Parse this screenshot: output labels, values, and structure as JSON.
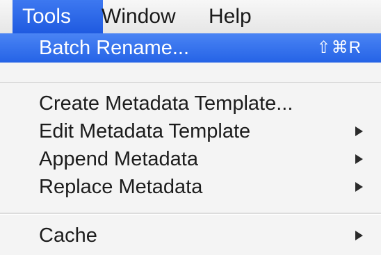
{
  "menubar": {
    "items": [
      {
        "label": "Tools"
      },
      {
        "label": "Window"
      },
      {
        "label": "Help"
      }
    ]
  },
  "menu": {
    "items": [
      {
        "label": "Batch Rename...",
        "shortcut": "⇧⌘R"
      },
      {
        "label": "Create Metadata Template..."
      },
      {
        "label": "Edit Metadata Template"
      },
      {
        "label": "Append Metadata"
      },
      {
        "label": "Replace Metadata"
      },
      {
        "label": "Cache"
      }
    ]
  },
  "colors": {
    "highlight": "#2563e6",
    "menu_bg": "#f4f4f4"
  }
}
